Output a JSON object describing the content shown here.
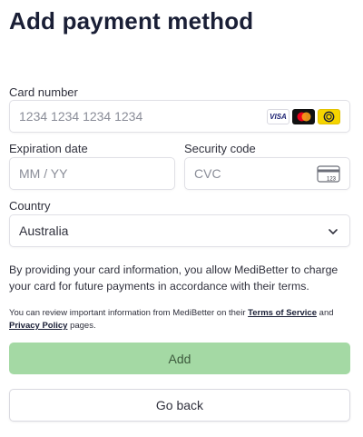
{
  "title": "Add payment method",
  "card_number": {
    "label": "Card number",
    "placeholder": "1234 1234 1234 1234",
    "brands": [
      {
        "name": "visa",
        "text": "VISA"
      },
      {
        "name": "mastercard",
        "text": ""
      },
      {
        "name": "jcb",
        "text": ""
      }
    ]
  },
  "expiration": {
    "label": "Expiration date",
    "placeholder": "MM / YY"
  },
  "security_code": {
    "label": "Security code",
    "placeholder": "CVC",
    "icon_text": "123"
  },
  "country": {
    "label": "Country",
    "value": "Australia"
  },
  "disclaimer": "By providing your card information, you allow MediBetter to charge your card for future payments in accordance with their terms.",
  "legal": {
    "prefix": "You can review important information from MediBetter on their ",
    "terms_link": "Terms of Service",
    "middle": " and ",
    "privacy_link": "Privacy Policy",
    "suffix": " pages."
  },
  "buttons": {
    "add": "Add",
    "back": "Go back"
  },
  "colors": {
    "add_button": "#a4d9a4",
    "text": "#30313d",
    "heading": "#1a1f36"
  }
}
